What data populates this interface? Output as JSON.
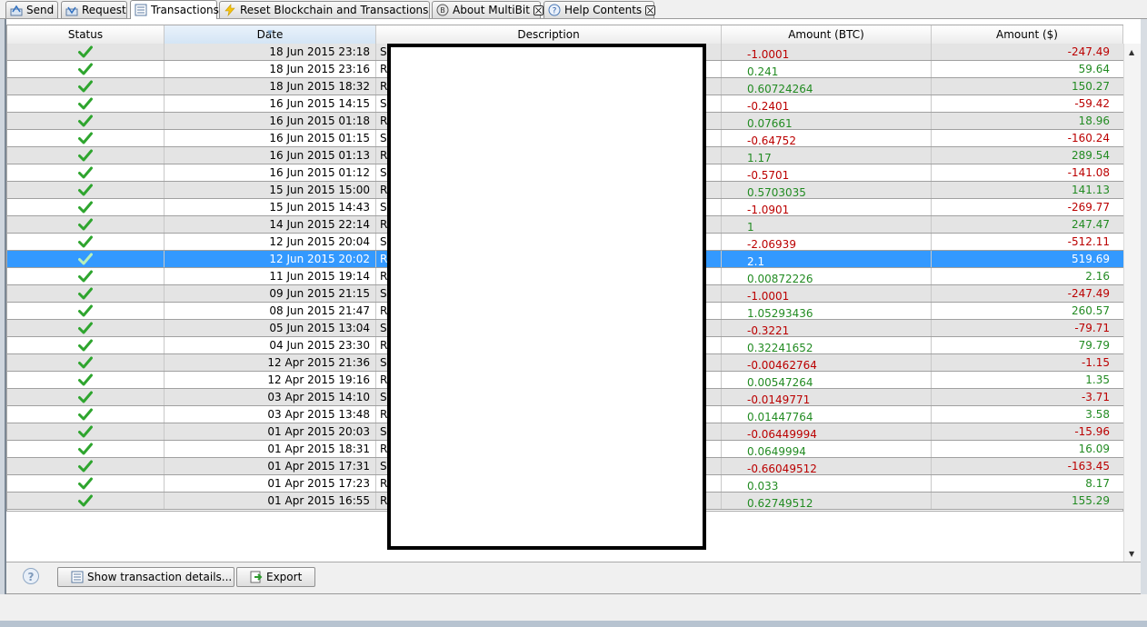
{
  "tabs": [
    {
      "label": "Send",
      "active": false,
      "closable": false,
      "icon": "send-icon"
    },
    {
      "label": "Request",
      "active": false,
      "closable": false,
      "icon": "request-icon"
    },
    {
      "label": "Transactions",
      "active": true,
      "closable": false,
      "icon": "transactions-icon"
    },
    {
      "label": "Reset Blockchain and Transactions",
      "active": false,
      "closable": true,
      "icon": "lightning-icon"
    },
    {
      "label": "About MultiBit",
      "active": false,
      "closable": true,
      "icon": "multibit-icon"
    },
    {
      "label": "Help Contents",
      "active": false,
      "closable": true,
      "icon": "help-icon"
    }
  ],
  "table": {
    "columns": [
      "Status",
      "Date",
      "Description",
      "Amount (BTC)",
      "Amount ($)"
    ],
    "sorted_column": "Date",
    "rows": [
      {
        "status": "confirmed",
        "date": "18 Jun 2015 23:18",
        "desc": "S",
        "btc": "-1.0001",
        "usd": "-247.49"
      },
      {
        "status": "confirmed",
        "date": "18 Jun 2015 23:16",
        "desc": "R",
        "btc": "0.241",
        "usd": "59.64"
      },
      {
        "status": "confirmed",
        "date": "18 Jun 2015 18:32",
        "desc": "R",
        "btc": "0.60724264",
        "usd": "150.27"
      },
      {
        "status": "confirmed",
        "date": "16 Jun 2015 14:15",
        "desc": "S",
        "btc": "-0.2401",
        "usd": "-59.42"
      },
      {
        "status": "confirmed",
        "date": "16 Jun 2015 01:18",
        "desc": "R",
        "btc": "0.07661",
        "usd": "18.96"
      },
      {
        "status": "confirmed",
        "date": "16 Jun 2015 01:15",
        "desc": "S",
        "btc": "-0.64752",
        "usd": "-160.24"
      },
      {
        "status": "confirmed",
        "date": "16 Jun 2015 01:13",
        "desc": "R",
        "btc": "1.17",
        "usd": "289.54"
      },
      {
        "status": "confirmed",
        "date": "16 Jun 2015 01:12",
        "desc": "S",
        "btc": "-0.5701",
        "usd": "-141.08"
      },
      {
        "status": "confirmed",
        "date": "15 Jun 2015 15:00",
        "desc": "R",
        "btc": "0.5703035",
        "usd": "141.13"
      },
      {
        "status": "confirmed",
        "date": "15 Jun 2015 14:43",
        "desc": "S",
        "btc": "-1.0901",
        "usd": "-269.77"
      },
      {
        "status": "confirmed",
        "date": "14 Jun 2015 22:14",
        "desc": "R",
        "btc": "1",
        "usd": "247.47"
      },
      {
        "status": "confirmed",
        "date": "12 Jun 2015 20:04",
        "desc": "S",
        "btc": "-2.06939",
        "usd": "-512.11"
      },
      {
        "status": "confirmed",
        "date": "12 Jun 2015 20:02",
        "desc": "R",
        "btc": "2.1",
        "usd": "519.69",
        "selected": true
      },
      {
        "status": "confirmed",
        "date": "11 Jun 2015 19:14",
        "desc": "R",
        "btc": "0.00872226",
        "usd": "2.16"
      },
      {
        "status": "confirmed",
        "date": "09 Jun 2015 21:15",
        "desc": "S",
        "btc": "-1.0001",
        "usd": "-247.49"
      },
      {
        "status": "confirmed",
        "date": "08 Jun 2015 21:47",
        "desc": "R",
        "btc": "1.05293436",
        "usd": "260.57"
      },
      {
        "status": "confirmed",
        "date": "05 Jun 2015 13:04",
        "desc": "S",
        "btc": "-0.3221",
        "usd": "-79.71"
      },
      {
        "status": "confirmed",
        "date": "04 Jun 2015 23:30",
        "desc": "R",
        "btc": "0.32241652",
        "usd": "79.79"
      },
      {
        "status": "confirmed",
        "date": "12 Apr 2015 21:36",
        "desc": "S",
        "btc": "-0.00462764",
        "usd": "-1.15"
      },
      {
        "status": "confirmed",
        "date": "12 Apr 2015 19:16",
        "desc": "R",
        "btc": "0.00547264",
        "usd": "1.35"
      },
      {
        "status": "confirmed",
        "date": "03 Apr 2015 14:10",
        "desc": "S",
        "btc": "-0.0149771",
        "usd": "-3.71"
      },
      {
        "status": "confirmed",
        "date": "03 Apr 2015 13:48",
        "desc": "R",
        "btc": "0.01447764",
        "usd": "3.58"
      },
      {
        "status": "confirmed",
        "date": "01 Apr 2015 20:03",
        "desc": "S",
        "btc": "-0.06449994",
        "usd": "-15.96"
      },
      {
        "status": "confirmed",
        "date": "01 Apr 2015 18:31",
        "desc": "R",
        "btc": "0.0649994",
        "usd": "16.09"
      },
      {
        "status": "confirmed",
        "date": "01 Apr 2015 17:31",
        "desc": "S",
        "btc": "-0.66049512",
        "usd": "-163.45"
      },
      {
        "status": "confirmed",
        "date": "01 Apr 2015 17:23",
        "desc": "R",
        "btc": "0.033",
        "usd": "8.17"
      },
      {
        "status": "confirmed",
        "date": "01 Apr 2015 16:55",
        "desc": "R",
        "btc": "0.62749512",
        "usd": "155.29"
      }
    ]
  },
  "footer": {
    "details_button": "Show transaction details...",
    "export_button": "Export"
  },
  "colors": {
    "selection": "#3399ff",
    "negative": "#bb0000",
    "positive": "#228b22",
    "check": "#2ea52e"
  }
}
